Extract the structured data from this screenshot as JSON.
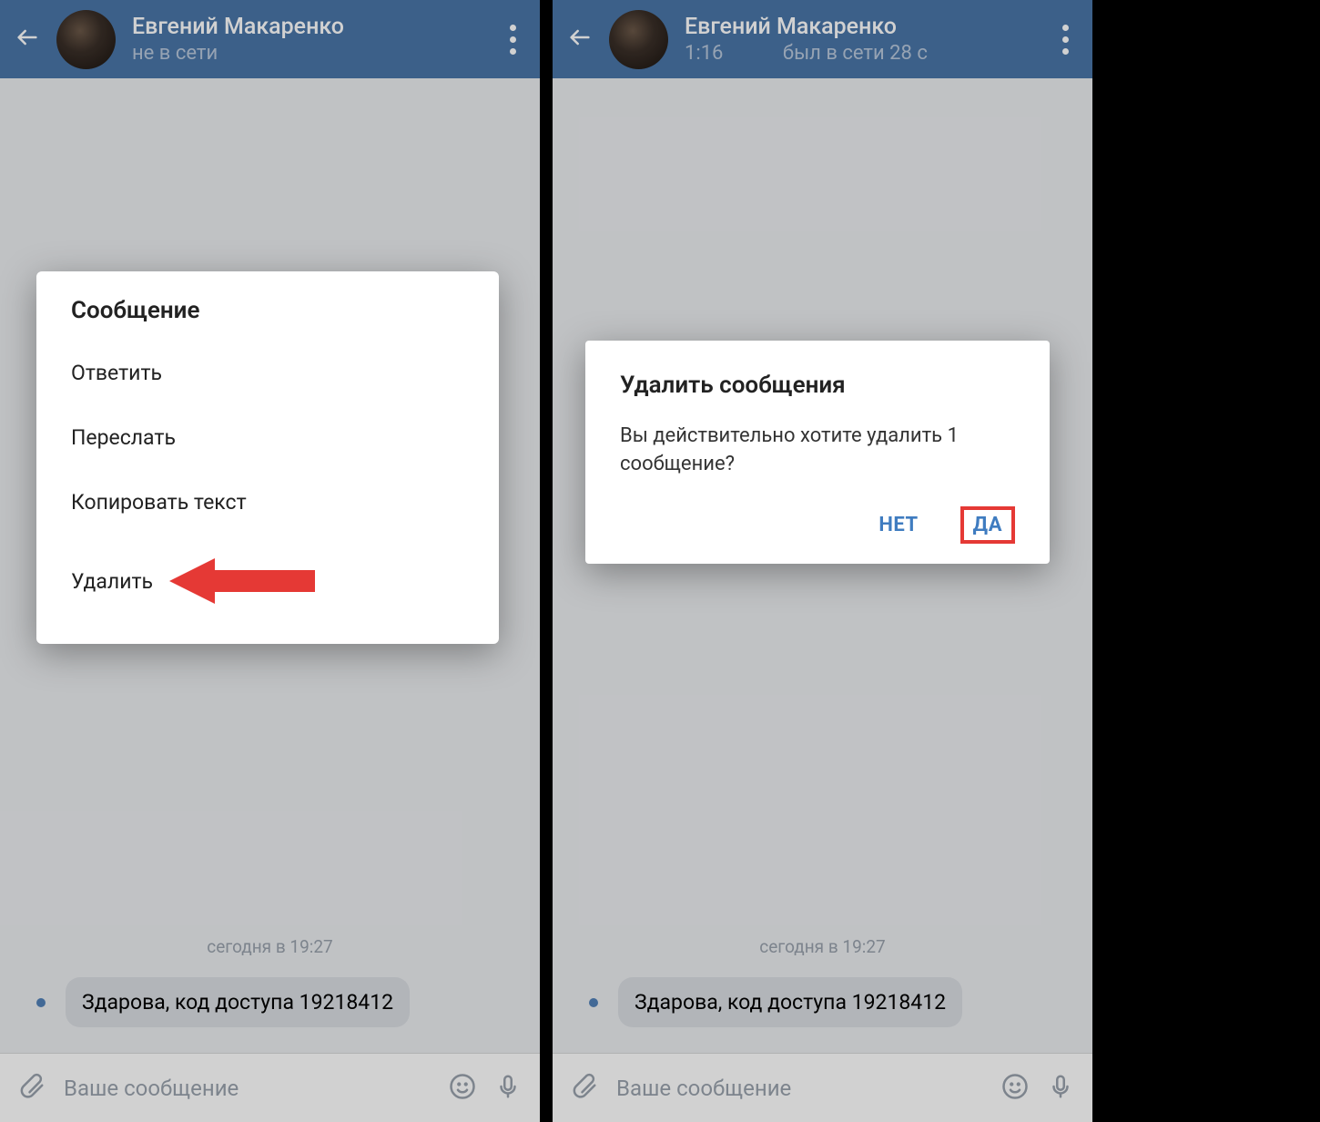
{
  "left": {
    "header": {
      "contact_name": "Евгений Макаренко",
      "status": "не в сети"
    },
    "chat": {
      "date_label": "сегодня в 19:27",
      "message_text": "Здарова, код доступа 19218412"
    },
    "input": {
      "placeholder": "Ваше сообщение"
    },
    "menu": {
      "title": "Сообщение",
      "items": [
        "Ответить",
        "Переслать",
        "Копировать текст",
        "Удалить"
      ]
    }
  },
  "right": {
    "header": {
      "contact_name": "Евгений Макаренко",
      "status_time": "1:16",
      "status_text": "был в сети 28 с"
    },
    "chat": {
      "date_label": "сегодня в 19:27",
      "message_text": "Здарова, код доступа 19218412"
    },
    "input": {
      "placeholder": "Ваше сообщение"
    },
    "confirm": {
      "title": "Удалить сообщения",
      "body": "Вы действительно хотите удалить 1 сообщение?",
      "no_label": "НЕТ",
      "yes_label": "ДА"
    }
  }
}
